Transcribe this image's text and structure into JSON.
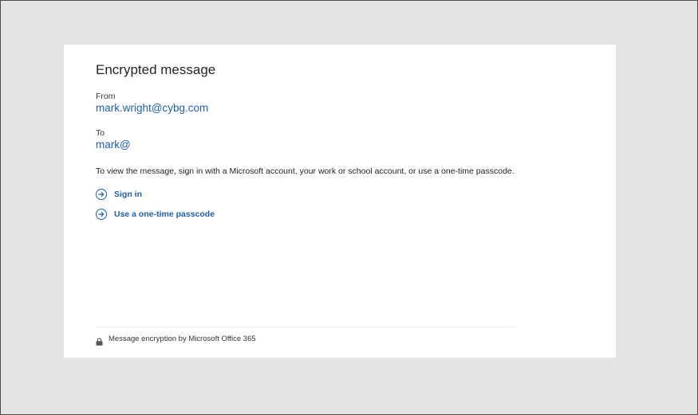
{
  "message": {
    "title": "Encrypted message",
    "from_label": "From",
    "from_email": "mark.wright@cybg.com",
    "to_label": "To",
    "to_email": "mark@",
    "instructions": "To view the message, sign in with a Microsoft account, your work or school account, or use a one-time passcode."
  },
  "actions": {
    "sign_in_label": "Sign in",
    "passcode_label": "Use a one-time passcode"
  },
  "footer": {
    "text": "Message encryption by Microsoft Office 365",
    "icon": "lock-icon"
  },
  "colors": {
    "link": "#1f5fae",
    "background": "#e4e4e5",
    "card": "#ffffff"
  }
}
